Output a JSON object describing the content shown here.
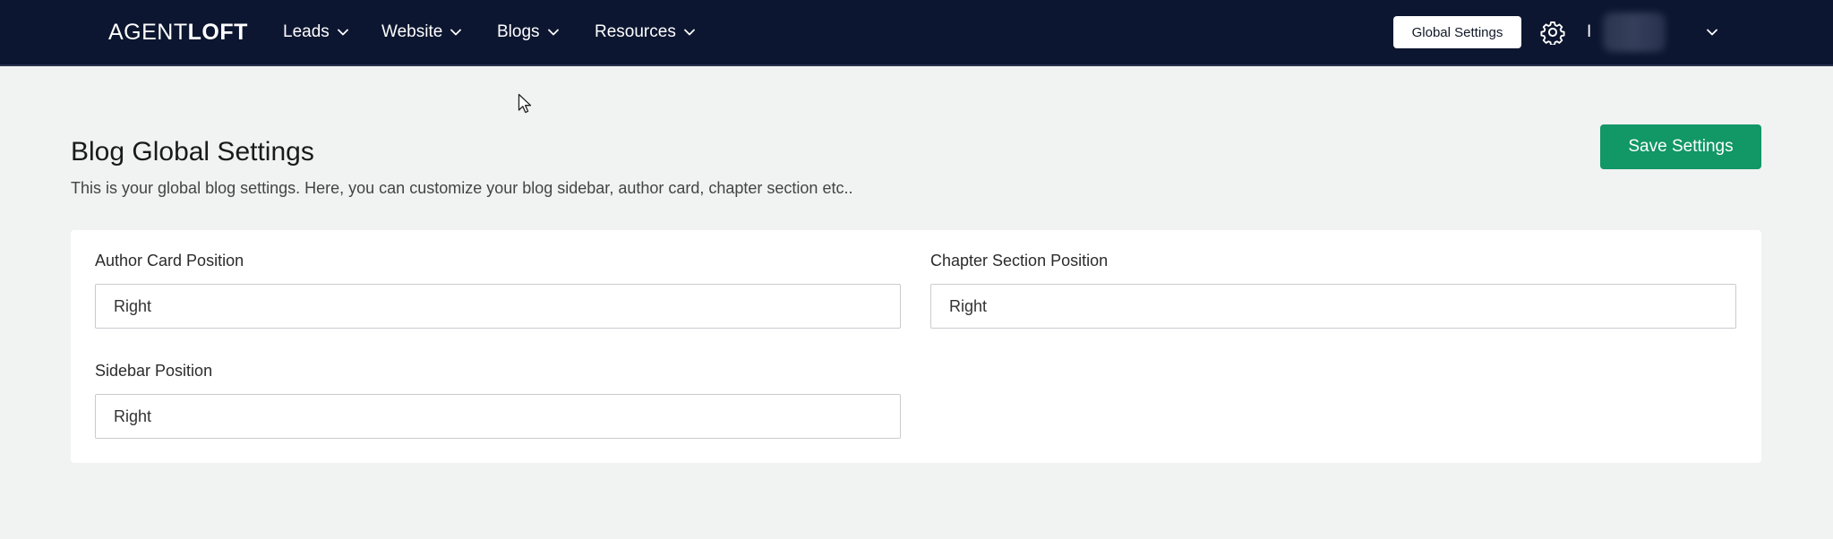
{
  "header": {
    "logo_light": "AGENT",
    "logo_bold": "LOFT",
    "nav": [
      {
        "label": "Leads"
      },
      {
        "label": "Website"
      },
      {
        "label": "Blogs"
      },
      {
        "label": "Resources"
      }
    ],
    "global_settings_label": "Global Settings",
    "user_initial": "I"
  },
  "main": {
    "title": "Blog Global Settings",
    "description": "This is your global blog settings. Here, you can customize your blog sidebar, author card, chapter section etc..",
    "save_label": "Save Settings"
  },
  "settings": {
    "author_card": {
      "label": "Author Card Position",
      "value": "Right"
    },
    "chapter_section": {
      "label": "Chapter Section Position",
      "value": "Right"
    },
    "sidebar": {
      "label": "Sidebar Position",
      "value": "Right"
    }
  },
  "icons": {
    "gear": "gear-icon",
    "chevron": "chevron-down-icon",
    "cursor": "mouse-cursor-icon"
  },
  "colors": {
    "nav_background": "#0c1630",
    "page_background": "#f1f2f2",
    "save_button": "#129766",
    "card_background": "#ffffff"
  }
}
